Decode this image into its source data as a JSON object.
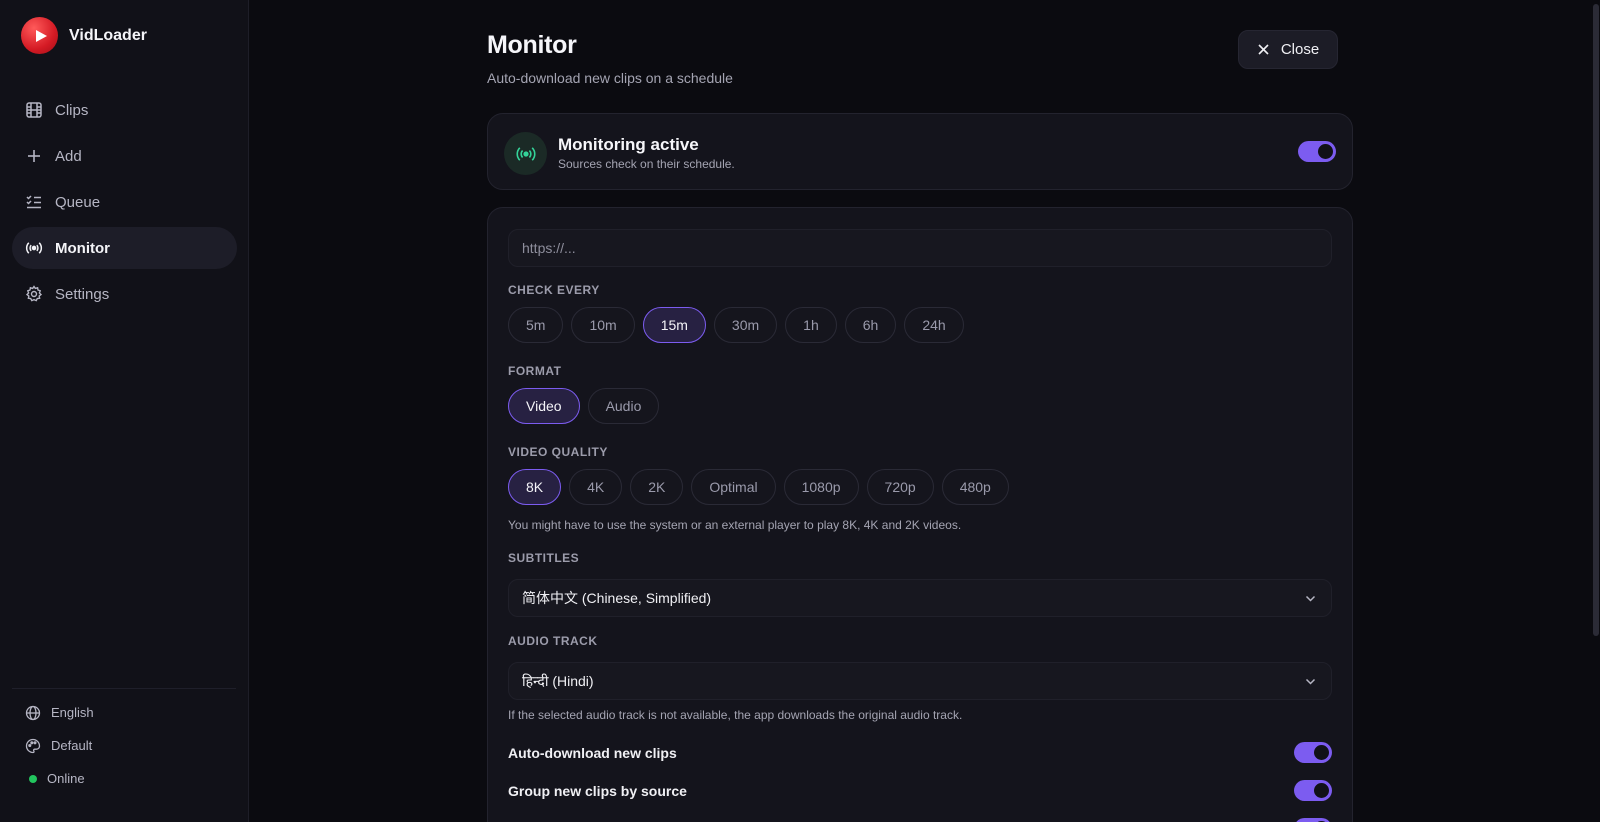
{
  "app": {
    "name": "VidLoader"
  },
  "sidebar": {
    "items": [
      {
        "label": "Clips",
        "icon": "film-icon"
      },
      {
        "label": "Add",
        "icon": "plus-icon"
      },
      {
        "label": "Queue",
        "icon": "list-check-icon"
      },
      {
        "label": "Monitor",
        "icon": "broadcast-icon",
        "active": true
      },
      {
        "label": "Settings",
        "icon": "gear-icon"
      }
    ],
    "footer": {
      "language": "English",
      "theme": "Default",
      "status": "Online",
      "status_color": "#22c55e"
    }
  },
  "page": {
    "title": "Monitor",
    "subtitle": "Auto-download new clips on a schedule",
    "close_label": "Close"
  },
  "status_card": {
    "title": "Monitoring active",
    "subtitle": "Sources check on their schedule.",
    "enabled": true
  },
  "form": {
    "url_placeholder": "https://...",
    "url_value": "",
    "check_every": {
      "label": "CHECK EVERY",
      "options": [
        "5m",
        "10m",
        "15m",
        "30m",
        "1h",
        "6h",
        "24h"
      ],
      "selected": "15m"
    },
    "format": {
      "label": "FORMAT",
      "options": [
        "Video",
        "Audio"
      ],
      "selected": "Video"
    },
    "video_quality": {
      "label": "VIDEO QUALITY",
      "options": [
        "8K",
        "4K",
        "2K",
        "Optimal",
        "1080p",
        "720p",
        "480p"
      ],
      "selected": "8K",
      "note": "You might have to use the system or an external player to play 8K, 4K and 2K videos."
    },
    "subtitles": {
      "label": "SUBTITLES",
      "value": "简体中文 (Chinese, Simplified)"
    },
    "audio_track": {
      "label": "AUDIO TRACK",
      "value": "हिन्दी (Hindi)",
      "note": "If the selected audio track is not available, the app downloads the original audio track."
    },
    "switches": [
      {
        "label": "Auto-download new clips",
        "enabled": true
      },
      {
        "label": "Group new clips by source",
        "enabled": true
      }
    ]
  },
  "colors": {
    "accent": "#7c5cf0",
    "brand": "#e11d26",
    "background": "#0b0b10"
  }
}
